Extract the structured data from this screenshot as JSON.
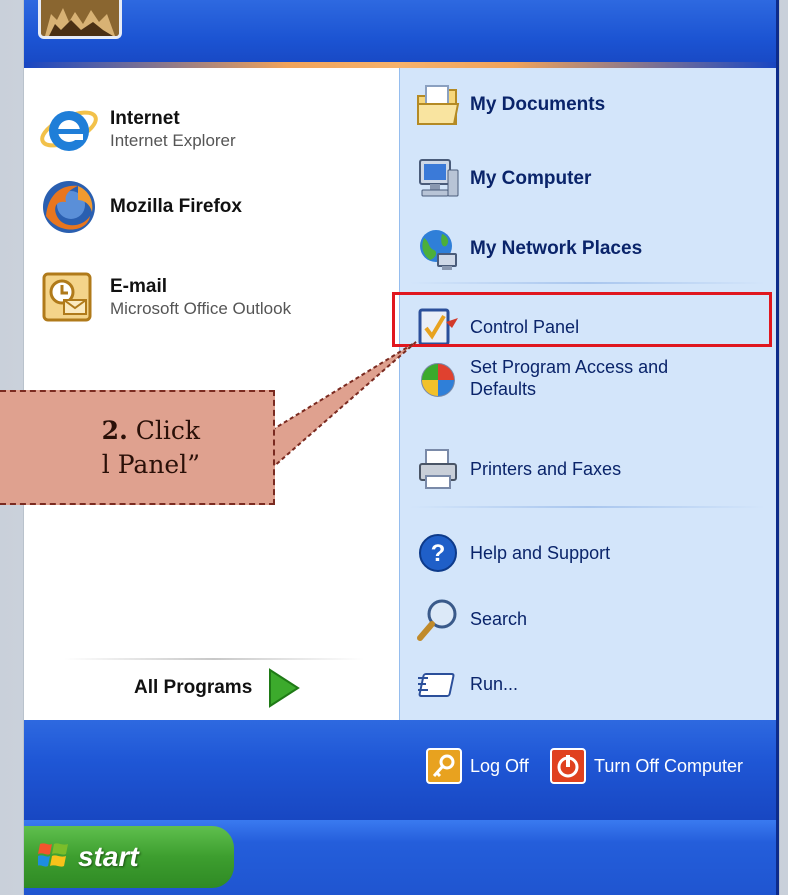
{
  "left_items": [
    {
      "title": "Internet",
      "subtitle": "Internet Explorer",
      "icon": "internet-explorer-icon"
    },
    {
      "title": "Mozilla Firefox",
      "subtitle": "",
      "icon": "firefox-icon"
    },
    {
      "title": "E-mail",
      "subtitle": "Microsoft Office Outlook",
      "icon": "outlook-icon"
    }
  ],
  "all_programs": {
    "label": "All Programs",
    "icon": "green-arrow-icon"
  },
  "right_items": [
    {
      "label": "My Documents",
      "icon": "my-documents-icon",
      "bold": true
    },
    {
      "label": "My Computer",
      "icon": "my-computer-icon",
      "bold": true
    },
    {
      "label": "My Network Places",
      "icon": "network-places-icon",
      "bold": true
    },
    {
      "label": "Control Panel",
      "icon": "control-panel-icon",
      "bold": false
    },
    {
      "label": "Set Program Access and Defaults",
      "icon": "program-access-icon",
      "bold": false
    },
    {
      "label": "Printers and Faxes",
      "icon": "printer-icon",
      "bold": false
    },
    {
      "label": "Help and Support",
      "icon": "help-icon",
      "bold": false
    },
    {
      "label": "Search",
      "icon": "search-icon",
      "bold": false
    },
    {
      "label": "Run...",
      "icon": "run-icon",
      "bold": false
    }
  ],
  "bottom": {
    "log_off": "Log Off",
    "turn_off": "Turn Off Computer"
  },
  "taskbar": {
    "start_label": "start"
  },
  "callout": {
    "step": "2.",
    "line1_rest": " Click",
    "line2": "l Panel”"
  },
  "colors": {
    "highlight": "#e0171f",
    "callout_fill": "#dfa18f",
    "xp_blue": "#1f55d0"
  }
}
